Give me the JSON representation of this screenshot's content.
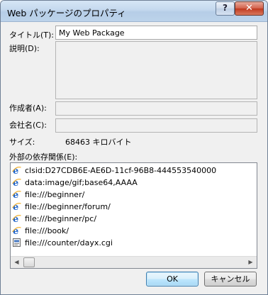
{
  "window": {
    "title": "Web パッケージのプロパティ",
    "help_label": "?",
    "close_label": "✕"
  },
  "form": {
    "title_label": "タイトル(T):",
    "title_value": "My Web Package",
    "description_label": "説明(D):",
    "description_value": "",
    "author_label": "作成者(A):",
    "author_value": "",
    "company_label": "会社名(C):",
    "company_value": "",
    "size_label": "サイズ:",
    "size_value": "68463 キロバイト"
  },
  "dependencies": {
    "label": "外部の依存関係(E):",
    "items": [
      {
        "icon": "ie-icon",
        "text": "clsid:D27CDB6E-AE6D-11cf-96B8-444553540000"
      },
      {
        "icon": "ie-icon",
        "text": "data:image/gif;base64,AAAA"
      },
      {
        "icon": "ie-icon",
        "text": "file:///beginner/"
      },
      {
        "icon": "ie-icon",
        "text": "file:///beginner/forum/"
      },
      {
        "icon": "ie-icon",
        "text": "file:///beginner/pc/"
      },
      {
        "icon": "ie-icon",
        "text": "file:///book/"
      },
      {
        "icon": "cgi-file-icon",
        "text": "file:///counter/dayx.cgi"
      }
    ]
  },
  "buttons": {
    "ok_label": "OK",
    "cancel_label": "キャンセル"
  },
  "colors": {
    "ie_blue": "#1e63c9",
    "ie_ring": "#f2b233",
    "ok_border": "#3c7fb1"
  }
}
